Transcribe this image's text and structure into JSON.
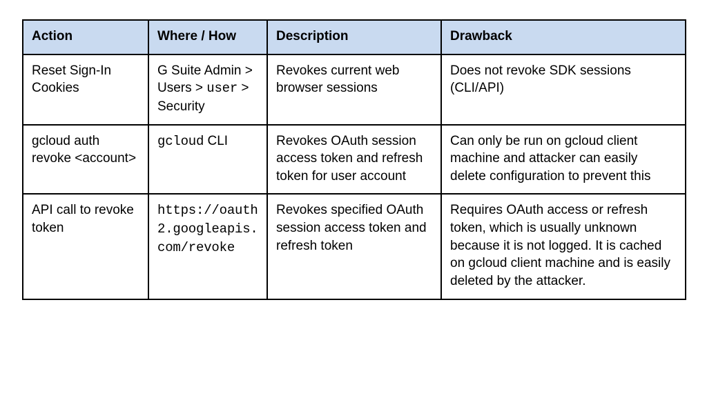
{
  "headers": {
    "action": "Action",
    "where": "Where / How",
    "description": "Description",
    "drawback": "Drawback"
  },
  "rows": [
    {
      "action": "Reset Sign-In Cookies",
      "where_prefix": "G Suite Admin > Users > ",
      "where_mono": "user",
      "where_suffix": " > Security",
      "description": "Revokes current web browser sessions",
      "drawback": "Does not revoke SDK sessions (CLI/API)"
    },
    {
      "action": "gcloud auth revoke <account>",
      "where_mono": "gcloud",
      "where_suffix": " CLI",
      "description": "Revokes OAuth session access token and refresh token for user account",
      "drawback": "Can only be run on gcloud client machine and attacker can easily delete configuration to prevent this"
    },
    {
      "action": "API call to revoke token",
      "where_mono": "https://oauth2.googleapis.com/revoke",
      "description": "Revokes specified OAuth session access token and refresh token",
      "drawback": "Requires OAuth access or refresh token, which is usually unknown because it is not logged. It is cached on gcloud client machine and is easily deleted by the attacker."
    }
  ]
}
